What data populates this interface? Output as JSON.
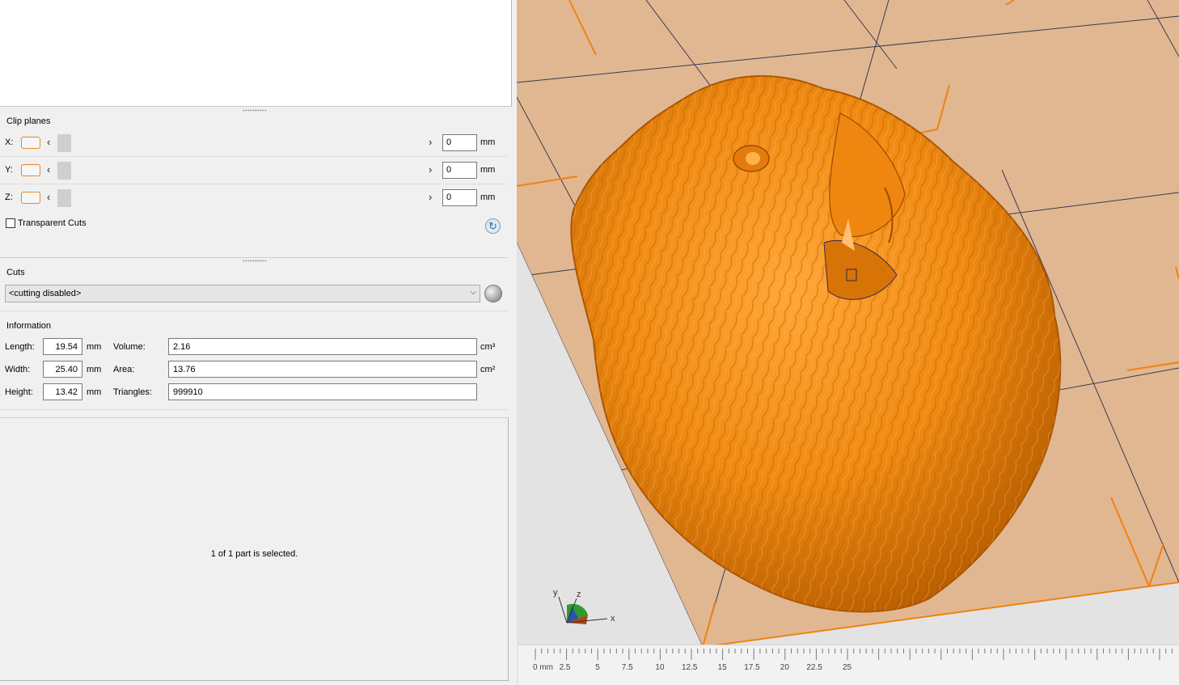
{
  "clip_planes": {
    "title": "Clip planes",
    "axes": [
      {
        "label": "X:",
        "value": "0",
        "unit": "mm"
      },
      {
        "label": "Y:",
        "value": "0",
        "unit": "mm"
      },
      {
        "label": "Z:",
        "value": "0",
        "unit": "mm"
      }
    ],
    "transparent_cuts_label": "Transparent Cuts",
    "transparent_cuts_checked": false
  },
  "cuts": {
    "title": "Cuts",
    "selected": "<cutting disabled>"
  },
  "information": {
    "title": "Information",
    "length_label": "Length:",
    "length_value": "19.54",
    "length_unit": "mm",
    "width_label": "Width:",
    "width_value": "25.40",
    "width_unit": "mm",
    "height_label": "Height:",
    "height_value": "13.42",
    "height_unit": "mm",
    "volume_label": "Volume:",
    "volume_value": "2.16",
    "volume_unit": "cm³",
    "area_label": "Area:",
    "area_value": "13.76",
    "area_unit": "cm²",
    "triangles_label": "Triangles:",
    "triangles_value": "999910"
  },
  "status": {
    "selection_text": "1 of 1 part is selected."
  },
  "viewport": {
    "axes_gizmo": {
      "x": "x",
      "y": "y",
      "z": "z"
    },
    "ruler_labels": [
      "0 mm",
      "2.5",
      "5",
      "7.5",
      "10",
      "12.5",
      "15",
      "17.5",
      "20",
      "22.5",
      "25"
    ],
    "colors": {
      "plate": "#e1b792",
      "model": "#f08a12",
      "accent": "#f0820f"
    }
  }
}
